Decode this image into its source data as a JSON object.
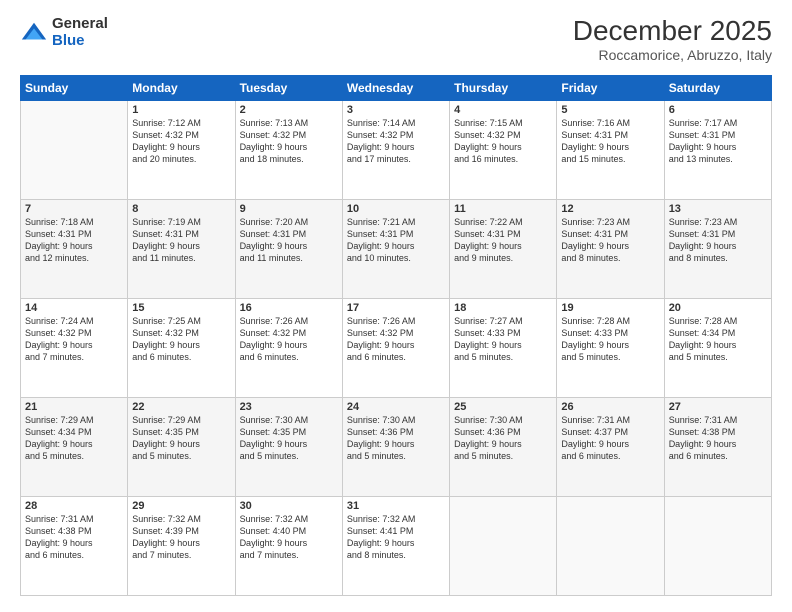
{
  "logo": {
    "general": "General",
    "blue": "Blue"
  },
  "title": "December 2025",
  "location": "Roccamorice, Abruzzo, Italy",
  "days_of_week": [
    "Sunday",
    "Monday",
    "Tuesday",
    "Wednesday",
    "Thursday",
    "Friday",
    "Saturday"
  ],
  "weeks": [
    [
      {
        "day": "",
        "info": ""
      },
      {
        "day": "1",
        "info": "Sunrise: 7:12 AM\nSunset: 4:32 PM\nDaylight: 9 hours\nand 20 minutes."
      },
      {
        "day": "2",
        "info": "Sunrise: 7:13 AM\nSunset: 4:32 PM\nDaylight: 9 hours\nand 18 minutes."
      },
      {
        "day": "3",
        "info": "Sunrise: 7:14 AM\nSunset: 4:32 PM\nDaylight: 9 hours\nand 17 minutes."
      },
      {
        "day": "4",
        "info": "Sunrise: 7:15 AM\nSunset: 4:32 PM\nDaylight: 9 hours\nand 16 minutes."
      },
      {
        "day": "5",
        "info": "Sunrise: 7:16 AM\nSunset: 4:31 PM\nDaylight: 9 hours\nand 15 minutes."
      },
      {
        "day": "6",
        "info": "Sunrise: 7:17 AM\nSunset: 4:31 PM\nDaylight: 9 hours\nand 13 minutes."
      }
    ],
    [
      {
        "day": "7",
        "info": "Sunrise: 7:18 AM\nSunset: 4:31 PM\nDaylight: 9 hours\nand 12 minutes."
      },
      {
        "day": "8",
        "info": "Sunrise: 7:19 AM\nSunset: 4:31 PM\nDaylight: 9 hours\nand 11 minutes."
      },
      {
        "day": "9",
        "info": "Sunrise: 7:20 AM\nSunset: 4:31 PM\nDaylight: 9 hours\nand 11 minutes."
      },
      {
        "day": "10",
        "info": "Sunrise: 7:21 AM\nSunset: 4:31 PM\nDaylight: 9 hours\nand 10 minutes."
      },
      {
        "day": "11",
        "info": "Sunrise: 7:22 AM\nSunset: 4:31 PM\nDaylight: 9 hours\nand 9 minutes."
      },
      {
        "day": "12",
        "info": "Sunrise: 7:23 AM\nSunset: 4:31 PM\nDaylight: 9 hours\nand 8 minutes."
      },
      {
        "day": "13",
        "info": "Sunrise: 7:23 AM\nSunset: 4:31 PM\nDaylight: 9 hours\nand 8 minutes."
      }
    ],
    [
      {
        "day": "14",
        "info": "Sunrise: 7:24 AM\nSunset: 4:32 PM\nDaylight: 9 hours\nand 7 minutes."
      },
      {
        "day": "15",
        "info": "Sunrise: 7:25 AM\nSunset: 4:32 PM\nDaylight: 9 hours\nand 6 minutes."
      },
      {
        "day": "16",
        "info": "Sunrise: 7:26 AM\nSunset: 4:32 PM\nDaylight: 9 hours\nand 6 minutes."
      },
      {
        "day": "17",
        "info": "Sunrise: 7:26 AM\nSunset: 4:32 PM\nDaylight: 9 hours\nand 6 minutes."
      },
      {
        "day": "18",
        "info": "Sunrise: 7:27 AM\nSunset: 4:33 PM\nDaylight: 9 hours\nand 5 minutes."
      },
      {
        "day": "19",
        "info": "Sunrise: 7:28 AM\nSunset: 4:33 PM\nDaylight: 9 hours\nand 5 minutes."
      },
      {
        "day": "20",
        "info": "Sunrise: 7:28 AM\nSunset: 4:34 PM\nDaylight: 9 hours\nand 5 minutes."
      }
    ],
    [
      {
        "day": "21",
        "info": "Sunrise: 7:29 AM\nSunset: 4:34 PM\nDaylight: 9 hours\nand 5 minutes."
      },
      {
        "day": "22",
        "info": "Sunrise: 7:29 AM\nSunset: 4:35 PM\nDaylight: 9 hours\nand 5 minutes."
      },
      {
        "day": "23",
        "info": "Sunrise: 7:30 AM\nSunset: 4:35 PM\nDaylight: 9 hours\nand 5 minutes."
      },
      {
        "day": "24",
        "info": "Sunrise: 7:30 AM\nSunset: 4:36 PM\nDaylight: 9 hours\nand 5 minutes."
      },
      {
        "day": "25",
        "info": "Sunrise: 7:30 AM\nSunset: 4:36 PM\nDaylight: 9 hours\nand 5 minutes."
      },
      {
        "day": "26",
        "info": "Sunrise: 7:31 AM\nSunset: 4:37 PM\nDaylight: 9 hours\nand 6 minutes."
      },
      {
        "day": "27",
        "info": "Sunrise: 7:31 AM\nSunset: 4:38 PM\nDaylight: 9 hours\nand 6 minutes."
      }
    ],
    [
      {
        "day": "28",
        "info": "Sunrise: 7:31 AM\nSunset: 4:38 PM\nDaylight: 9 hours\nand 6 minutes."
      },
      {
        "day": "29",
        "info": "Sunrise: 7:32 AM\nSunset: 4:39 PM\nDaylight: 9 hours\nand 7 minutes."
      },
      {
        "day": "30",
        "info": "Sunrise: 7:32 AM\nSunset: 4:40 PM\nDaylight: 9 hours\nand 7 minutes."
      },
      {
        "day": "31",
        "info": "Sunrise: 7:32 AM\nSunset: 4:41 PM\nDaylight: 9 hours\nand 8 minutes."
      },
      {
        "day": "",
        "info": ""
      },
      {
        "day": "",
        "info": ""
      },
      {
        "day": "",
        "info": ""
      }
    ]
  ]
}
